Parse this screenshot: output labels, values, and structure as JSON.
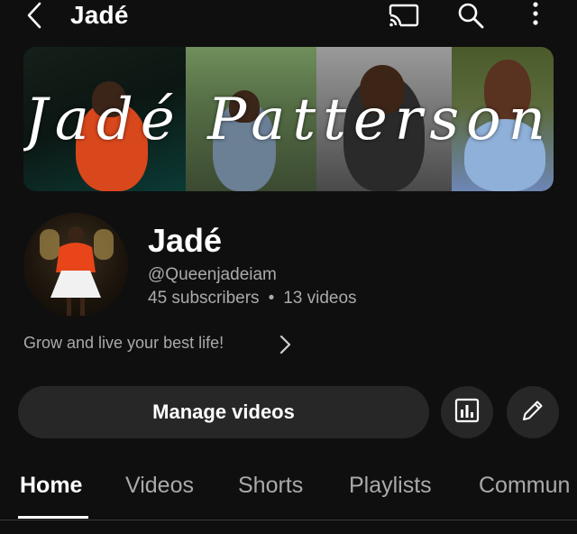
{
  "topbar": {
    "title": "Jadé",
    "back_icon": "back-chevron-icon",
    "cast_icon": "cast-icon",
    "search_icon": "search-icon",
    "more_icon": "more-vertical-icon"
  },
  "banner": {
    "name_text": "Jadé Patterson"
  },
  "channel": {
    "name": "Jadé",
    "handle": "@Queenjadeiam",
    "subscribers": "45 subscribers",
    "separator": "•",
    "videos": "13 videos",
    "description": "Grow and live your best life!"
  },
  "actions": {
    "manage_videos_label": "Manage videos",
    "analytics_icon": "analytics-icon",
    "edit_icon": "pencil-icon"
  },
  "tabs": [
    {
      "label": "Home",
      "active": true
    },
    {
      "label": "Videos",
      "active": false
    },
    {
      "label": "Shorts",
      "active": false
    },
    {
      "label": "Playlists",
      "active": false
    },
    {
      "label": "Commun",
      "active": false
    }
  ],
  "colors": {
    "background": "#0f0f0f",
    "button_bg": "#272727",
    "secondary_text": "#aaaaaa",
    "primary_text": "#ffffff"
  }
}
